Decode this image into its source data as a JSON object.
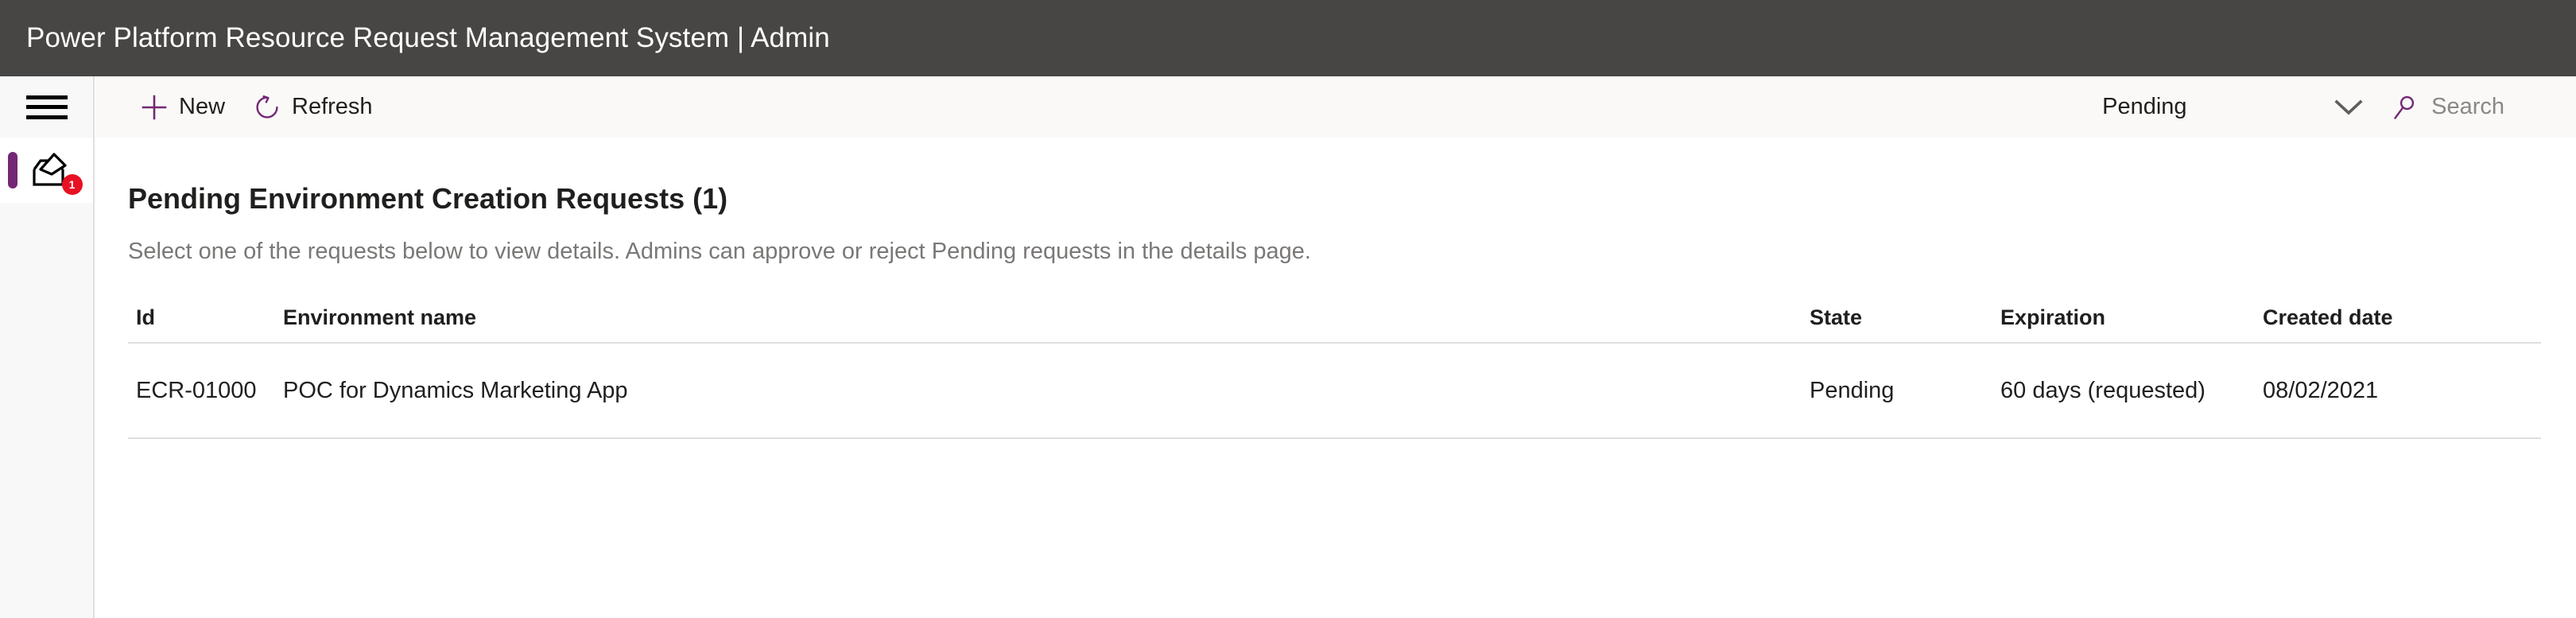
{
  "titlebar": {
    "title": "Power Platform Resource Request Management System | Admin"
  },
  "rail": {
    "hamburger_icon": "hamburger-menu-icon",
    "nav_item": {
      "icon": "inbox-tray-icon",
      "badge": "1"
    }
  },
  "commandbar": {
    "new": {
      "label": "New",
      "icon": "plus-icon"
    },
    "refresh": {
      "label": "Refresh",
      "icon": "refresh-circular-arrow-icon"
    },
    "filter": {
      "value": "Pending",
      "icon": "chevron-down-icon"
    },
    "search": {
      "placeholder": "Search",
      "icon": "search-magnifier-icon"
    }
  },
  "main": {
    "title": "Pending Environment Creation Requests (1)",
    "subtitle": "Select one of the requests below to view details. Admins can approve or reject Pending requests in the details page.",
    "table": {
      "columns": [
        "Id",
        "Environment name",
        "State",
        "Expiration",
        "Created date"
      ],
      "rows": [
        {
          "id": "ECR-01000",
          "environment_name": "POC for Dynamics Marketing App",
          "state": "Pending",
          "expiration": "60 days (requested)",
          "created_date": "08/02/2021"
        }
      ]
    }
  },
  "colors": {
    "titlebar_bg": "#484644",
    "accent_purple": "#742774",
    "badge_red": "#e81123",
    "commandbar_bg": "#faf9f8",
    "rail_bg": "#f8f8f8",
    "divider": "#e1dfdd",
    "text_primary": "#201f1e",
    "text_secondary": "#7a7876",
    "placeholder": "#8a8886"
  }
}
